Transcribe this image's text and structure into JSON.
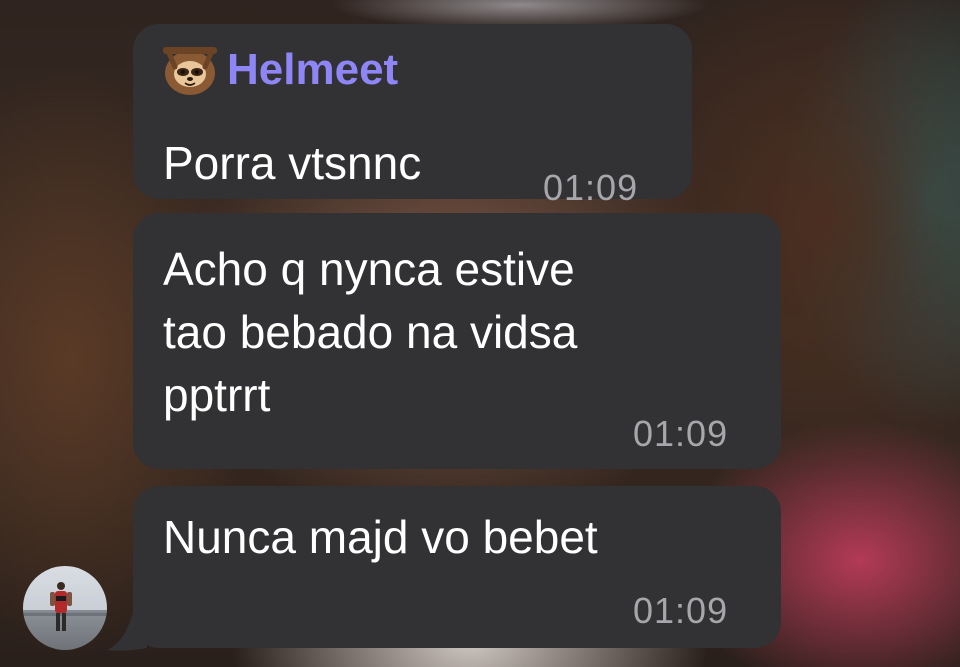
{
  "chat": {
    "messages": [
      {
        "sender": "Helmeet",
        "sender_emoji": "sloth-emoji",
        "text": "Porra vtsnnc",
        "time": "01:09"
      },
      {
        "text": "Acho q nynca estive\ntao bebado na vidsa\npptrrt",
        "time": "01:09"
      },
      {
        "text": "Nunca majd vo bebet",
        "time": "01:09"
      }
    ],
    "avatar_icon": "user-avatar-photo"
  },
  "colors": {
    "bubble": "#323234",
    "sender_name": "#8e86f6",
    "time_text": "#a7a7ab",
    "message_text": "#ffffff"
  }
}
